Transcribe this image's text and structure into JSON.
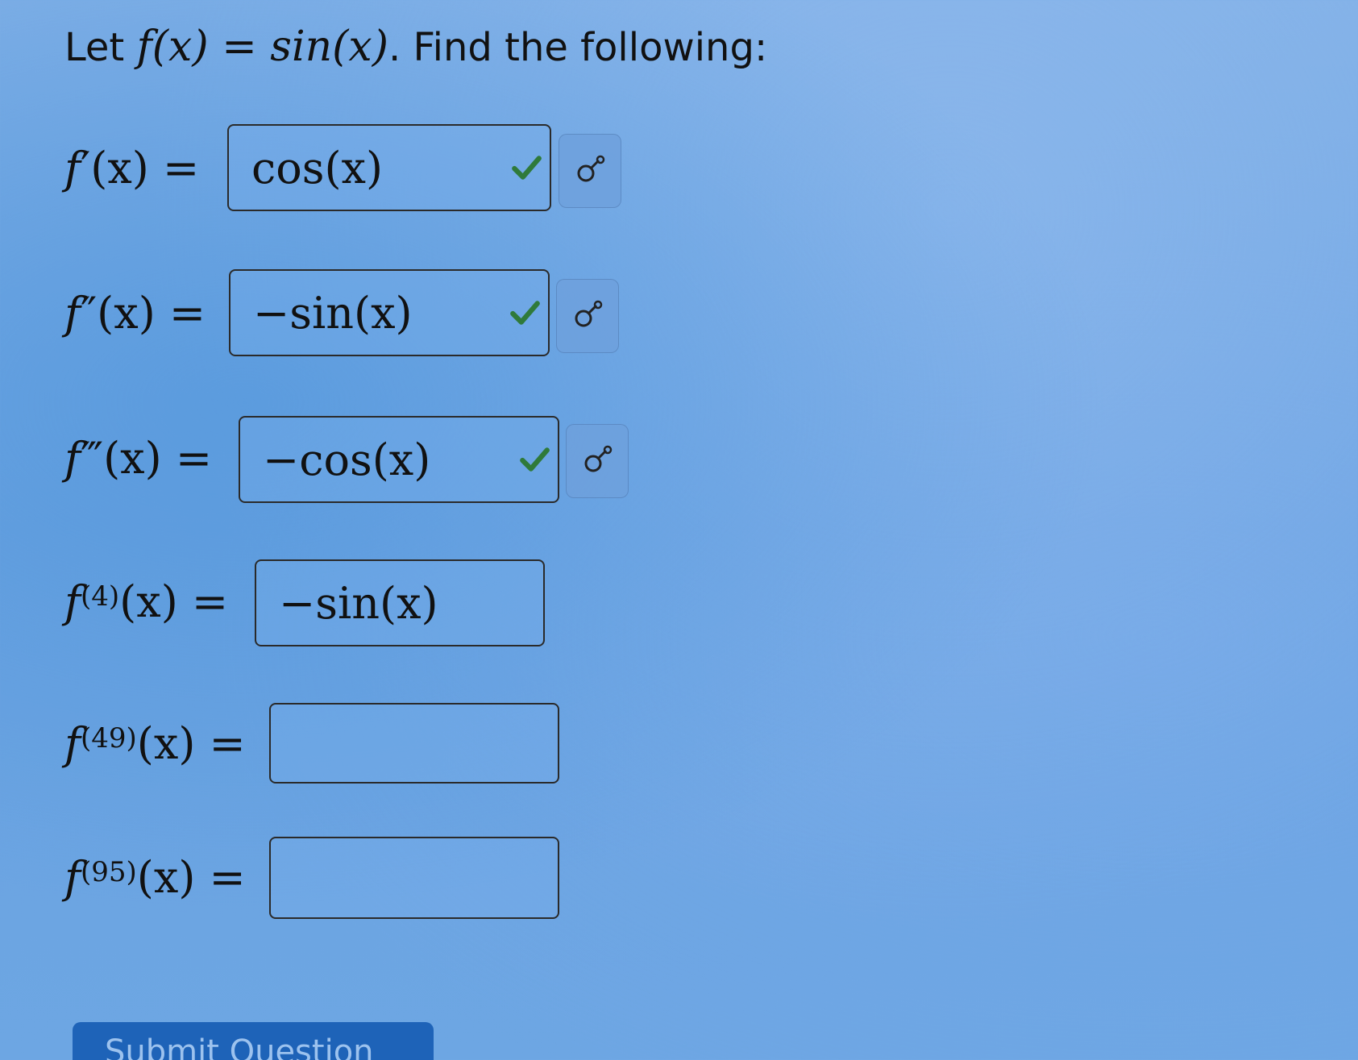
{
  "prompt": {
    "lead": "Let",
    "function_def": "f(x) = sin(x)",
    "tail": ". Find the following:"
  },
  "rows": [
    {
      "lhs_base": "f",
      "lhs_mark": "′",
      "lhs_arg": "(x) =",
      "value": "cos(x)",
      "status": "correct",
      "preview_icon": "preview-icon"
    },
    {
      "lhs_base": "f",
      "lhs_mark": "″",
      "lhs_arg": "(x) =",
      "value": "−sin(x)",
      "status": "correct",
      "preview_icon": "preview-icon"
    },
    {
      "lhs_base": "f",
      "lhs_mark": "‴",
      "lhs_arg": "(x) =",
      "value": "−cos(x)",
      "status": "correct",
      "preview_icon": "preview-icon"
    },
    {
      "lhs_base": "f",
      "lhs_sup": "(4)",
      "lhs_arg": "(x) =",
      "value": "−sin(x)",
      "status": "none"
    },
    {
      "lhs_base": "f",
      "lhs_sup": "(49)",
      "lhs_arg": "(x) =",
      "value": "",
      "status": "none"
    },
    {
      "lhs_base": "f",
      "lhs_sup": "(95)",
      "lhs_arg": "(x) =",
      "value": "",
      "status": "none"
    }
  ],
  "submit": {
    "label": "Submit Question"
  },
  "colors": {
    "check": "#2f7a3a",
    "submit_bg": "#1e63b8"
  }
}
